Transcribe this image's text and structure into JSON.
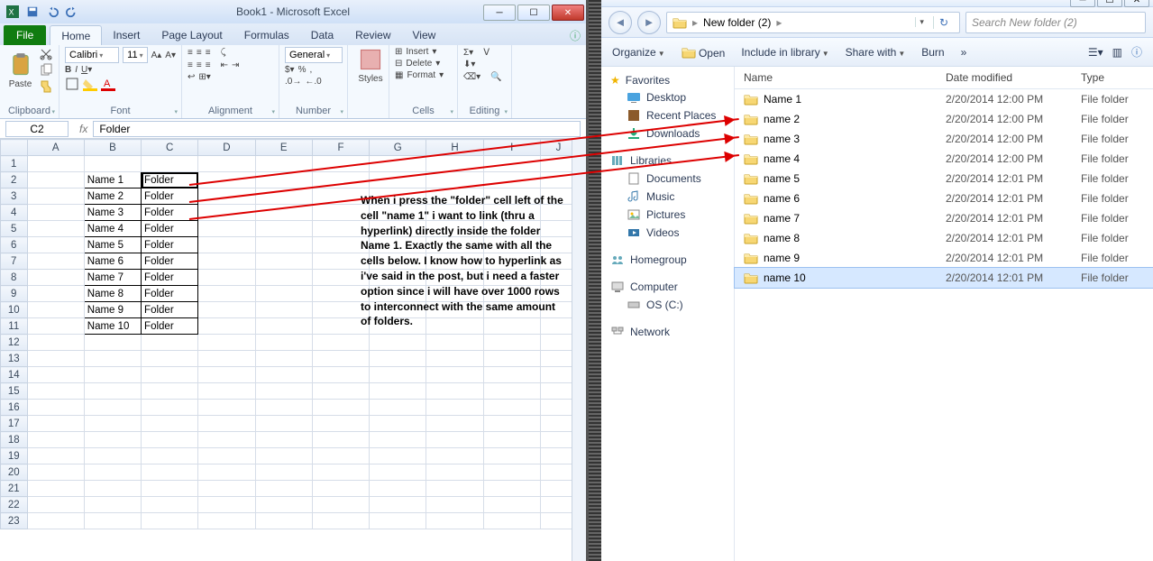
{
  "excel": {
    "title": "Book1 - Microsoft Excel",
    "tabs": {
      "file": "File",
      "home": "Home",
      "insert": "Insert",
      "pageLayout": "Page Layout",
      "formulas": "Formulas",
      "data": "Data",
      "review": "Review",
      "view": "View"
    },
    "ribbon": {
      "clipboard": {
        "label": "Clipboard",
        "paste": "Paste"
      },
      "font": {
        "label": "Font",
        "name": "Calibri",
        "size": "11"
      },
      "alignment": {
        "label": "Alignment"
      },
      "number": {
        "label": "Number",
        "format": "General"
      },
      "styles": {
        "label": "Styles"
      },
      "cells": {
        "label": "Cells",
        "insert": "Insert",
        "delete": "Delete",
        "format": "Format"
      },
      "editing": {
        "label": "Editing"
      }
    },
    "namebox": "C2",
    "formula": "Folder",
    "columns": [
      "A",
      "B",
      "C",
      "D",
      "E",
      "F",
      "G",
      "H",
      "I",
      "J"
    ],
    "rows": [
      {
        "n": "1",
        "b": "",
        "c": ""
      },
      {
        "n": "2",
        "b": "Name 1",
        "c": "Folder"
      },
      {
        "n": "3",
        "b": "Name 2",
        "c": "Folder"
      },
      {
        "n": "4",
        "b": "Name 3",
        "c": "Folder"
      },
      {
        "n": "5",
        "b": "Name 4",
        "c": "Folder"
      },
      {
        "n": "6",
        "b": "Name 5",
        "c": "Folder"
      },
      {
        "n": "7",
        "b": "Name 6",
        "c": "Folder"
      },
      {
        "n": "8",
        "b": "Name 7",
        "c": "Folder"
      },
      {
        "n": "9",
        "b": "Name 8",
        "c": "Folder"
      },
      {
        "n": "10",
        "b": "Name 9",
        "c": "Folder"
      },
      {
        "n": "11",
        "b": "Name 10",
        "c": "Folder"
      },
      {
        "n": "12"
      },
      {
        "n": "13"
      },
      {
        "n": "14"
      },
      {
        "n": "15"
      },
      {
        "n": "16"
      },
      {
        "n": "17"
      },
      {
        "n": "18"
      },
      {
        "n": "19"
      },
      {
        "n": "20"
      },
      {
        "n": "21"
      },
      {
        "n": "22"
      },
      {
        "n": "23"
      }
    ],
    "note": "When i press the \"folder\" cell left of the cell \"name 1\" i want to link (thru a hyperlink) directly inside the folder Name 1. Exactly the same with all the cells below. I know how to hyperlink as i've said in the post, but i need a faster option since i will have over 1000 rows to interconnect with the same amount of folders."
  },
  "explorer": {
    "breadcrumb": {
      "root": "",
      "folder": "New folder (2)"
    },
    "searchPlaceholder": "Search New folder (2)",
    "cmd": {
      "organize": "Organize",
      "open": "Open",
      "include": "Include in library",
      "share": "Share with",
      "burn": "Burn"
    },
    "tree": {
      "favorites": "Favorites",
      "desktop": "Desktop",
      "recent": "Recent Places",
      "downloads": "Downloads",
      "libraries": "Libraries",
      "documents": "Documents",
      "music": "Music",
      "pictures": "Pictures",
      "videos": "Videos",
      "homegroup": "Homegroup",
      "computer": "Computer",
      "osc": "OS (C:)",
      "network": "Network"
    },
    "list": {
      "headers": {
        "name": "Name",
        "date": "Date modified",
        "type": "Type"
      },
      "items": [
        {
          "name": "Name 1",
          "date": "2/20/2014 12:00 PM",
          "type": "File folder"
        },
        {
          "name": "name 2",
          "date": "2/20/2014 12:00 PM",
          "type": "File folder"
        },
        {
          "name": "name 3",
          "date": "2/20/2014 12:00 PM",
          "type": "File folder"
        },
        {
          "name": "name 4",
          "date": "2/20/2014 12:00 PM",
          "type": "File folder"
        },
        {
          "name": "name 5",
          "date": "2/20/2014 12:01 PM",
          "type": "File folder"
        },
        {
          "name": "name 6",
          "date": "2/20/2014 12:01 PM",
          "type": "File folder"
        },
        {
          "name": "name 7",
          "date": "2/20/2014 12:01 PM",
          "type": "File folder"
        },
        {
          "name": "name 8",
          "date": "2/20/2014 12:01 PM",
          "type": "File folder"
        },
        {
          "name": "name 9",
          "date": "2/20/2014 12:01 PM",
          "type": "File folder"
        },
        {
          "name": "name 10",
          "date": "2/20/2014 12:01 PM",
          "type": "File folder"
        }
      ]
    }
  }
}
